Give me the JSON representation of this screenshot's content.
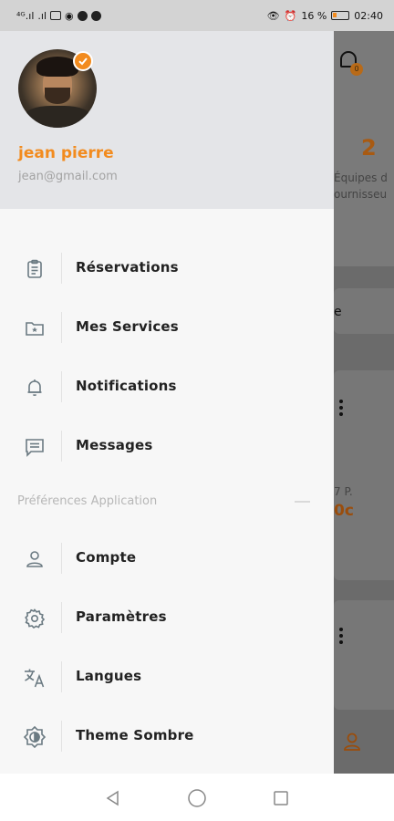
{
  "status_bar": {
    "battery": "16 %",
    "time": "02:40"
  },
  "background_app": {
    "notification_count": "0",
    "stat_number": "2",
    "stat_label_line1": "Équipes d",
    "stat_label_line2": "ournisseu",
    "card_text_fragment": "e",
    "card_small_fragment": "7 P.",
    "card_price_fragment": "0c"
  },
  "profile": {
    "name": "jean pierre",
    "email": "jean@gmail.com"
  },
  "menu": {
    "reservations": "Réservations",
    "services": "Mes Services",
    "notifications": "Notifications",
    "messages": "Messages",
    "preferences_title": "Préférences Application",
    "account": "Compte",
    "settings": "Paramètres",
    "languages": "Langues",
    "dark_theme": "Theme Sombre"
  },
  "colors": {
    "accent": "#f28b1e",
    "icon": "#6b7a82"
  }
}
